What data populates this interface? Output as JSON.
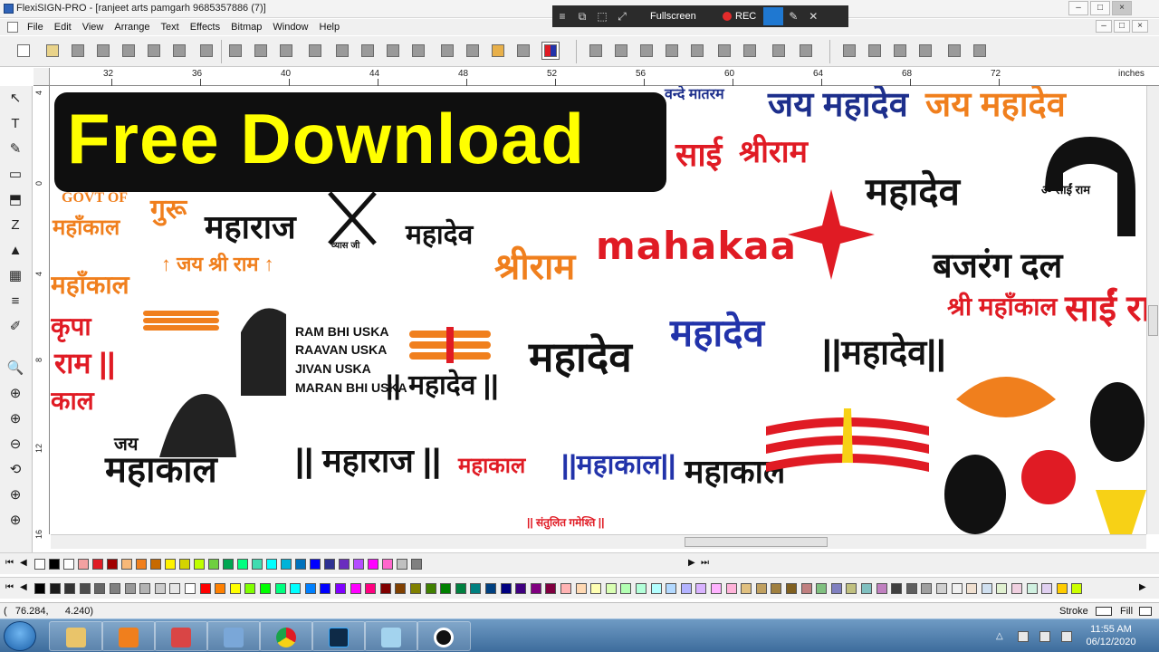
{
  "window": {
    "title": "FlexiSIGN-PRO - [ranjeet arts pamgarh 9685357886  (7)]",
    "controls": [
      "–",
      "□",
      "×"
    ],
    "doc_controls": [
      "–",
      "□",
      "×"
    ]
  },
  "recorder": {
    "icons": [
      "≡",
      "⧉",
      "⬚",
      "⤢"
    ],
    "fullscreen_label": "Fullscreen",
    "rec_label": "REC",
    "pen_icon": "✎",
    "close_icon": "✕"
  },
  "menu": {
    "items": [
      "File",
      "Edit",
      "View",
      "Arrange",
      "Text",
      "Effects",
      "Bitmap",
      "Window",
      "Help"
    ]
  },
  "ruler": {
    "units": "inches",
    "h_labels": [
      "32",
      "36",
      "40",
      "44",
      "48",
      "52",
      "56",
      "60",
      "64",
      "68",
      "72"
    ],
    "v_labels": [
      "4",
      "0",
      "4",
      "8",
      "12",
      "16"
    ]
  },
  "left_tools": [
    "↖",
    "T",
    "✎",
    "▭",
    "⬒",
    "Z",
    "▲",
    "▦",
    "≡",
    "✐",
    "🔍",
    "⊕",
    "⊕",
    "⊖",
    "⟲",
    "⊕",
    "⊕"
  ],
  "banner": {
    "text": "Free Download"
  },
  "artwork": [
    {
      "text": "महाराज",
      "color": "#111111"
    },
    {
      "text": "गुरू",
      "color": "#f07f1d"
    },
    {
      "text": "GOVT OF",
      "color": "#f07f1d"
    },
    {
      "text": "महाँकाल",
      "color": "#f07f1d"
    },
    {
      "text": "↑ जय श्री राम ↑",
      "color": "#f07f1d"
    },
    {
      "text": "व्यास जी",
      "color": "#111111"
    },
    {
      "text": "महादेव",
      "color": "#111111"
    },
    {
      "text": "श्रीराम",
      "color": "#f07f1d"
    },
    {
      "text": "mahakaa",
      "color": "#e01b24"
    },
    {
      "text": "साई",
      "color": "#e01b24"
    },
    {
      "text": "श्रीराम",
      "color": "#e01b24"
    },
    {
      "text": "वन्दे मातरम",
      "color": "#1d2f8c"
    },
    {
      "text": "जय महादेव",
      "color": "#1d2f8c"
    },
    {
      "text": "जय महादेव",
      "color": "#f07f1d"
    },
    {
      "text": "महादेव",
      "color": "#111111"
    },
    {
      "text": "ॐ साईं राम",
      "color": "#111111"
    },
    {
      "text": "बजरंग दल",
      "color": "#111111"
    },
    {
      "text": "श्री महाँकाल",
      "color": "#e01b24"
    },
    {
      "text": "साईं राम",
      "color": "#e01b24"
    },
    {
      "text": "महाँकाल",
      "color": "#f07f1d"
    },
    {
      "text": "कृपा",
      "color": "#e01b24"
    },
    {
      "text": "राम ||",
      "color": "#e01b24"
    },
    {
      "text": "काल",
      "color": "#e01b24"
    },
    {
      "text": "RAM BHI USKA",
      "color": "#111111"
    },
    {
      "text": "RAAVAN USKA",
      "color": "#111111"
    },
    {
      "text": "JIVAN USKA",
      "color": "#111111"
    },
    {
      "text": "MARAN BHI USKA",
      "color": "#111111"
    },
    {
      "text": "|| महादेव ||",
      "color": "#111111"
    },
    {
      "text": "महादेव",
      "color": "#111111"
    },
    {
      "text": "महादेव",
      "color": "#2233aa"
    },
    {
      "text": "||महादेव||",
      "color": "#111111"
    },
    {
      "text": "जय",
      "color": "#111111"
    },
    {
      "text": "महाकाल",
      "color": "#111111"
    },
    {
      "text": "|| महाराज ||",
      "color": "#111111"
    },
    {
      "text": "महाकाल",
      "color": "#e01b24"
    },
    {
      "text": "||महाकाल||",
      "color": "#2233aa"
    },
    {
      "text": "महाकाल",
      "color": "#111111"
    },
    {
      "text": "|| संतुलित गमेश्ति ||",
      "color": "#e01b24"
    }
  ],
  "palette_row1": [
    "#ffffff",
    "#000000",
    "#ffffff",
    "#f4a1a1",
    "#e01b24",
    "#a00000",
    "#f8b878",
    "#f07f1d",
    "#c76a00",
    "#fff200",
    "#d4d400",
    "#bfff00",
    "#6fcf3f",
    "#00a651",
    "#00ff80",
    "#3fdcb0",
    "#00ffff",
    "#00b3d9",
    "#0072bc",
    "#0000ff",
    "#2e3192",
    "#6a2cbf",
    "#b44cff",
    "#ff00ff",
    "#ff66cc",
    "#c0c0c0",
    "#808080"
  ],
  "palette_row2": [
    "#000000",
    "#1a1a1a",
    "#333333",
    "#4d4d4d",
    "#666666",
    "#808080",
    "#999999",
    "#b3b3b3",
    "#cccccc",
    "#e6e6e6",
    "#ffffff",
    "#ff0000",
    "#ff8000",
    "#ffff00",
    "#80ff00",
    "#00ff00",
    "#00ff80",
    "#00ffff",
    "#0080ff",
    "#0000ff",
    "#8000ff",
    "#ff00ff",
    "#ff0080",
    "#800000",
    "#804000",
    "#808000",
    "#408000",
    "#008000",
    "#008040",
    "#008080",
    "#004080",
    "#000080",
    "#400080",
    "#800080",
    "#800040",
    "#ffb3b3",
    "#ffd9b3",
    "#ffffb3",
    "#d9ffb3",
    "#b3ffb3",
    "#b3ffd9",
    "#b3ffff",
    "#b3d9ff",
    "#b3b3ff",
    "#d9b3ff",
    "#ffb3ff",
    "#ffb3d9",
    "#e0c080",
    "#c0a060",
    "#a08040",
    "#806020",
    "#c08080",
    "#80c080",
    "#8080c0",
    "#c0c080",
    "#80c0c0",
    "#c080c0",
    "#404040",
    "#606060",
    "#a0a0a0",
    "#d0d0d0",
    "#f0f0f0",
    "#f0e0d0",
    "#d0e0f0",
    "#e0f0d0",
    "#f0d0e0",
    "#d0f0e0",
    "#e0d0f0",
    "#ffcc00",
    "#ccff00"
  ],
  "status": {
    "coords": "(   76.284,      4.240)",
    "stroke_label": "Stroke",
    "fill_label": "Fill"
  },
  "taskbar": {
    "clock_time": "11:55 AM",
    "clock_date": "06/12/2020"
  }
}
